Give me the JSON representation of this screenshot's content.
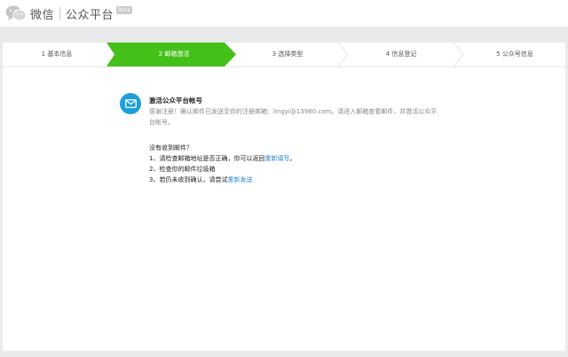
{
  "header": {
    "brand": "微信",
    "platform": "公众平台",
    "beta": "Beta"
  },
  "steps": [
    {
      "label": "1 基本信息",
      "active": false
    },
    {
      "label": "2 邮箱激活",
      "active": true
    },
    {
      "label": "3 选择类型",
      "active": false
    },
    {
      "label": "4 信息登记",
      "active": false
    },
    {
      "label": "5 公众号信息",
      "active": false
    }
  ],
  "colors": {
    "accent_green": "#45c01a",
    "link_blue": "#2a86d0",
    "icon_blue": "#1e9fdc"
  },
  "content": {
    "icon": "mail-icon",
    "title": "激活公众平台帐号",
    "desc_line1": "感谢注册！确认邮件已发送至你的注册邮箱：lingyi@13980.com。请进入邮箱查看邮件，并激活公众平",
    "desc_line2": "台帐号。",
    "help_title": "没有收到邮件？",
    "help_item1_prefix": "1、请检查邮箱地址是否正确，你可以返回",
    "help_item1_link": "重新填写",
    "help_item1_suffix": "。",
    "help_item2": "2、检查你的邮件垃圾箱",
    "help_item3_prefix": "3、若仍未收到确认，请尝试",
    "help_item3_link": "重新发送"
  }
}
